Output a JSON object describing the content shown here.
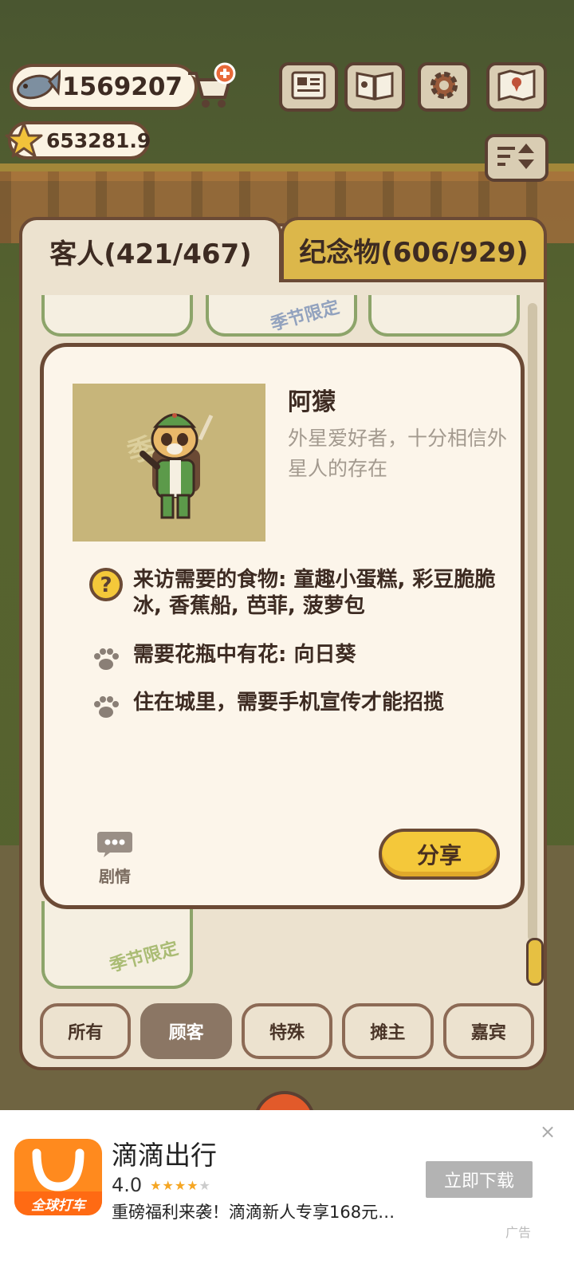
{
  "hud": {
    "fish_count": "1569207",
    "star_count": "653281.9"
  },
  "tabs": {
    "guests_label": "客人(421/467)",
    "souvenirs_label": "纪念物(606/929)"
  },
  "grid": {
    "season_tag": "季节限定"
  },
  "guest_detail": {
    "name": "阿獴",
    "description": "外星爱好者，十分相信外星人的存在",
    "portrait_tag": "季",
    "requirements": [
      {
        "icon": "question-icon",
        "text": "来访需要的食物: 童趣小蛋糕, 彩豆脆脆冰, 香蕉船, 芭菲, 菠萝包"
      },
      {
        "icon": "paw-icon",
        "text": "需要花瓶中有花: 向日葵"
      },
      {
        "icon": "paw-icon",
        "text": "住在城里，需要手机宣传才能招揽"
      }
    ],
    "story_label": "剧情",
    "share_label": "分享"
  },
  "filters": {
    "items": [
      "所有",
      "顾客",
      "特殊",
      "摊主",
      "嘉宾"
    ],
    "active": "顾客"
  },
  "ad": {
    "title": "滴滴出行",
    "rating": "4.0",
    "text": "重磅福利来袭！滴滴新人专享168元…",
    "cta": "立即下载",
    "logo_tag": "全球打车",
    "label": "广告"
  },
  "colors": {
    "accent_yellow": "#f4c83a",
    "brown_border": "#6b4a35",
    "ad_orange": "#ff6a13"
  }
}
